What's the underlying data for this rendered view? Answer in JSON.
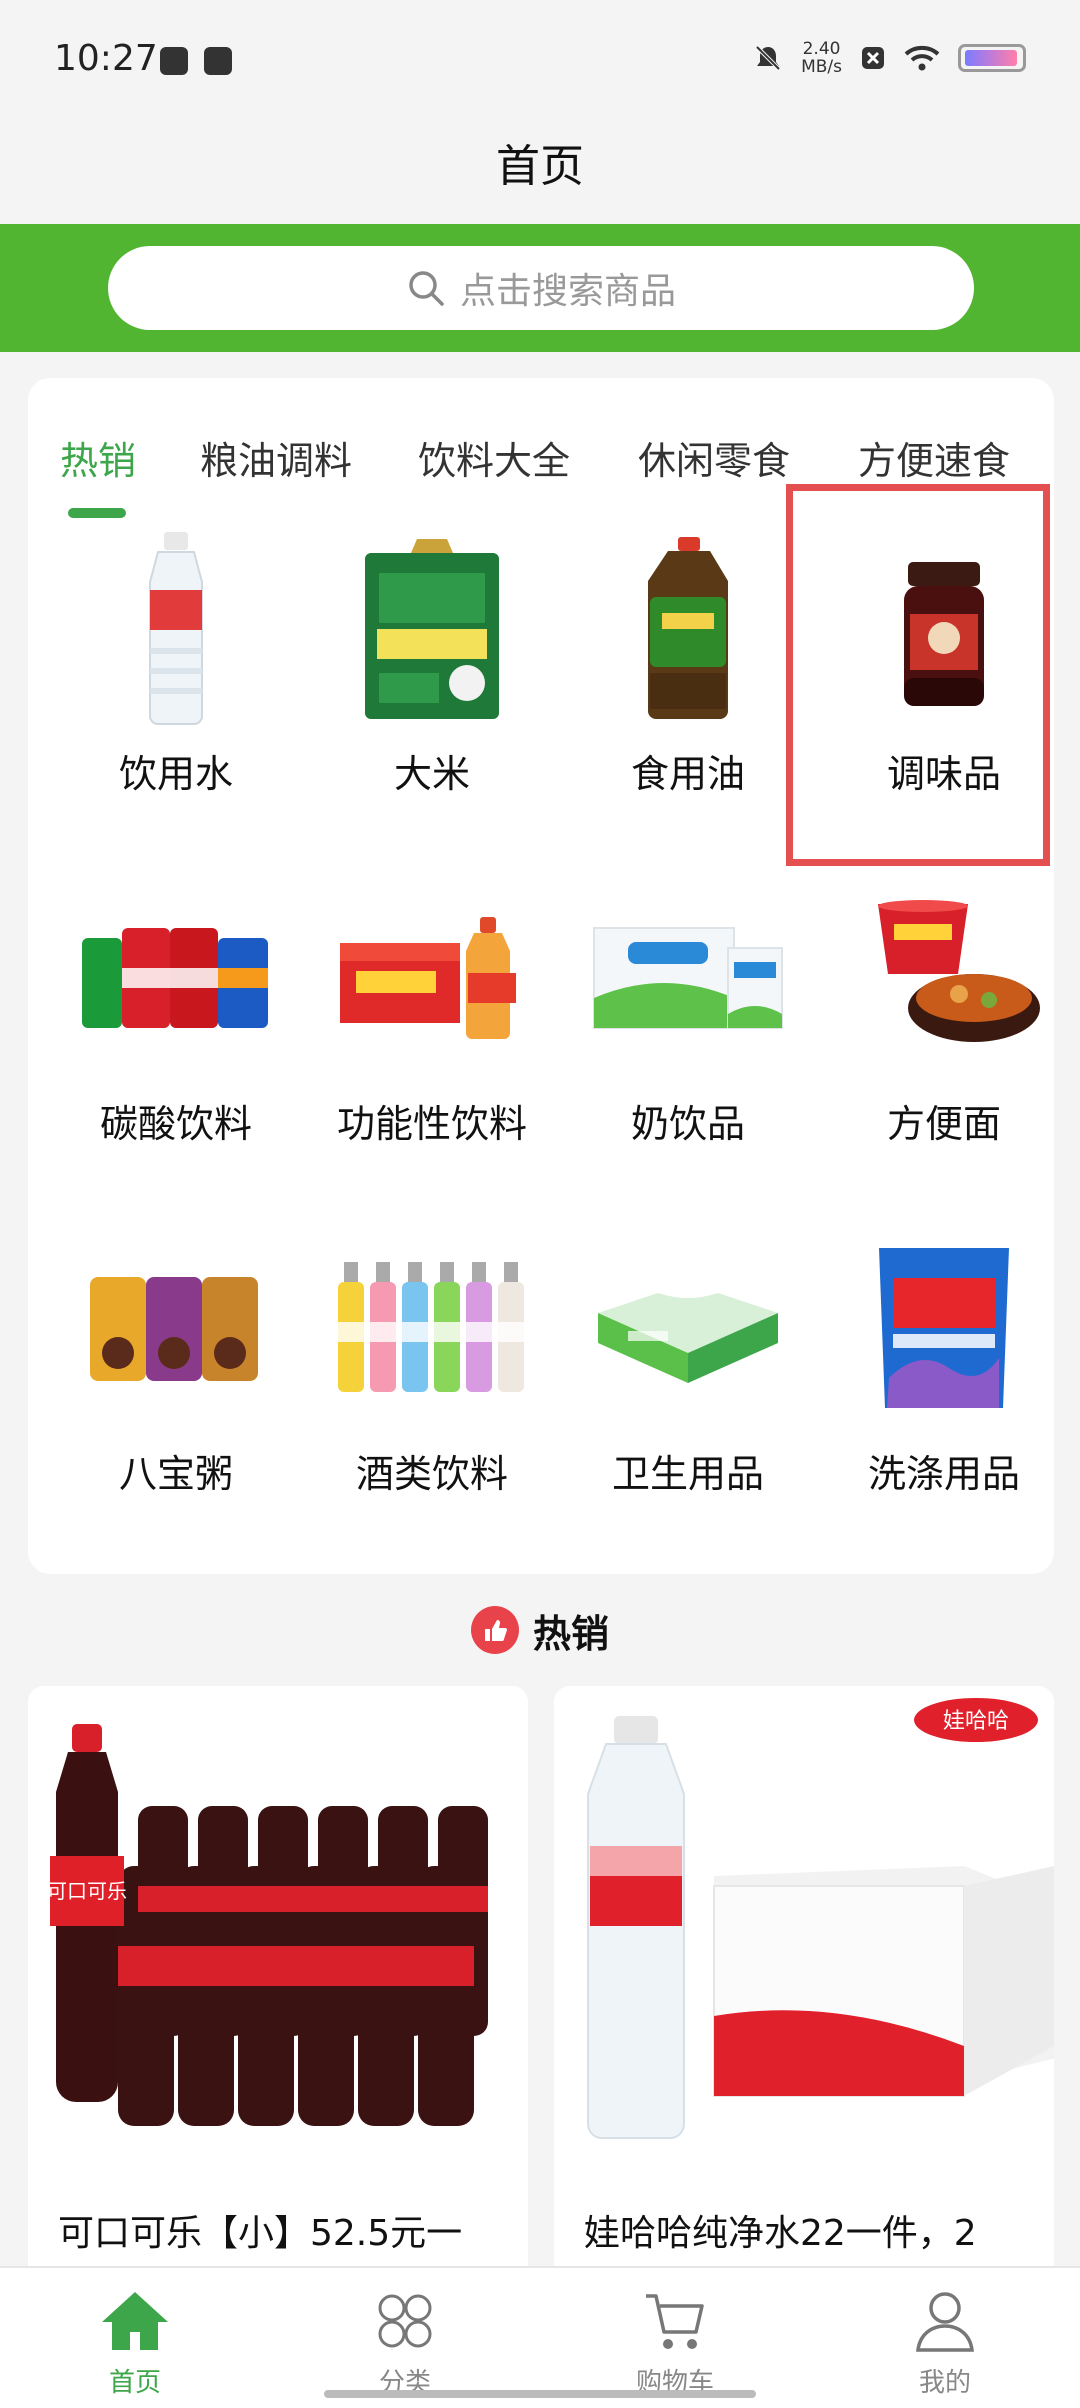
{
  "status_bar": {
    "time": "10:27",
    "net_speed": "2.40",
    "net_unit": "MB/s"
  },
  "header": {
    "title": "首页"
  },
  "search": {
    "placeholder": "点击搜索商品"
  },
  "tabs": [
    {
      "label": "热销",
      "active": true
    },
    {
      "label": "粮油调料",
      "active": false
    },
    {
      "label": "饮料大全",
      "active": false
    },
    {
      "label": "休闲零食",
      "active": false
    },
    {
      "label": "方便速食",
      "active": false
    }
  ],
  "categories": [
    {
      "label": "饮用水",
      "icon": "water-bottle-image"
    },
    {
      "label": "大米",
      "icon": "rice-bag-image"
    },
    {
      "label": "食用油",
      "icon": "oil-bottle-image"
    },
    {
      "label": "调味品",
      "icon": "chili-sauce-jar-image"
    },
    {
      "label": "碳酸饮料",
      "icon": "soda-cans-image"
    },
    {
      "label": "功能性饮料",
      "icon": "functional-drink-image"
    },
    {
      "label": "奶饮品",
      "icon": "milk-box-image"
    },
    {
      "label": "方便面",
      "icon": "instant-noodle-image"
    },
    {
      "label": "八宝粥",
      "icon": "congee-cans-image"
    },
    {
      "label": "酒类饮料",
      "icon": "rio-bottles-image"
    },
    {
      "label": "卫生用品",
      "icon": "wet-wipes-image"
    },
    {
      "label": "洗涤用品",
      "icon": "detergent-bag-image"
    }
  ],
  "hot_section": {
    "title": "热销"
  },
  "products": [
    {
      "name": "可口可乐【小】52.5元一",
      "logo_text": "可口可乐"
    },
    {
      "name": "娃哈哈纯净水22一件，2",
      "logo_text": "娃哈哈"
    }
  ],
  "bottom_nav": [
    {
      "label": "首页",
      "icon": "home-icon",
      "active": true
    },
    {
      "label": "分类",
      "icon": "category-grid-icon",
      "active": false
    },
    {
      "label": "购物车",
      "icon": "cart-icon",
      "active": false
    },
    {
      "label": "我的",
      "icon": "user-icon",
      "active": false
    }
  ],
  "colors": {
    "accent": "#52b531",
    "active_text": "#3ea64a",
    "highlight_border": "#e3504f"
  }
}
